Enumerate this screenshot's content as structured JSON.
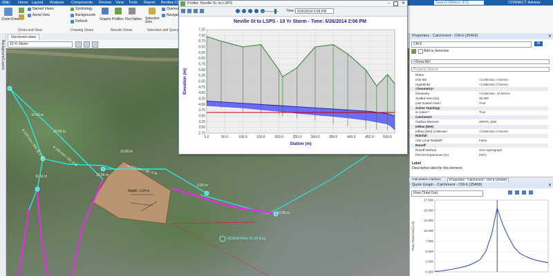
{
  "menu": [
    "File",
    "Home",
    "Layout",
    "Analysis",
    "Components",
    "Review",
    "View",
    "Tools",
    "Report",
    "Bentley Cloud Services"
  ],
  "search_placeholder": "Search Ribbon (F3)",
  "connect_label": "CONNECT Advisor",
  "ribbon": {
    "zoom_extents": "Zoom Extents",
    "named_views": "Named Views",
    "aerial_view": "Aerial View",
    "symbology": "Symbology",
    "backgrounds": "Backgrounds",
    "refresh": "Refresh",
    "graphs": "Graphs",
    "profiles": "Profiles",
    "flextables": "FlexTables",
    "selection_sets": "Selection Sets",
    "queries": "Queries",
    "navigator": "Navigator",
    "group_zoom": "Zoom and View",
    "group_drawing": "Drawing Views",
    "group_results": "Results Views",
    "group_selection": "Selection and Query"
  },
  "left_strip": "Background Layers",
  "drawing_tab": "Gerstown.stsw",
  "scenario": "10 Yr Storm",
  "profile_window": {
    "title": "Profile: Neville St. to LSPS",
    "time_label": "Time:",
    "time_value": "6/26/2014 2:06 PM",
    "chart_title": "Neville St  to LSPS - 10 Yr Storm - Time: 6/26/2014 2:06 PM",
    "xlabel": "Station (m)",
    "ylabel": "Elevation (m)"
  },
  "chart_data": [
    {
      "type": "line",
      "title": "Neville St  to LSPS - 10 Yr Storm - Time: 6/26/2014 2:06 PM",
      "xlabel": "Station (m)",
      "ylabel": "Elevation (m)",
      "xlim": [
        0,
        520
      ],
      "ylim": [
        2.75,
        7.25
      ],
      "xticks": [
        "0.0",
        "50.0",
        "100.0",
        "150.0",
        "200.0",
        "250.0",
        "300.0",
        "350.0",
        "400.0",
        "450.0",
        "500.0"
      ],
      "yticks": [
        "2.75",
        "3.00",
        "3.25",
        "3.50",
        "3.75",
        "4.00",
        "4.25",
        "4.50",
        "4.75",
        "5.00",
        "5.25",
        "5.50",
        "5.75",
        "6.00",
        "6.25",
        "6.50",
        "6.75",
        "7.00",
        "7.25"
      ],
      "series": [
        {
          "name": "",
          "color": "#2e7d32",
          "x": [
            0,
            40,
            100,
            150,
            200,
            210,
            250,
            300,
            350,
            390,
            440,
            470,
            500,
            520
          ],
          "y": [
            6.95,
            6.75,
            6.5,
            6.6,
            5.5,
            5.2,
            5.6,
            6.5,
            6.6,
            6.2,
            5.5,
            4.8,
            5.3,
            4.9
          ]
        },
        {
          "name": "",
          "color": "#1e1ea8",
          "x": [
            0,
            100,
            200,
            250,
            300,
            350,
            400,
            450,
            500,
            510,
            520
          ],
          "y": [
            4.15,
            4.05,
            3.95,
            3.9,
            3.85,
            3.8,
            3.75,
            3.7,
            3.6,
            3.55,
            3.5
          ]
        },
        {
          "name": "",
          "color": "#5a5aff",
          "x": [
            0,
            100,
            200,
            250,
            300,
            350,
            400,
            450,
            500,
            510,
            520
          ],
          "y": [
            3.95,
            3.85,
            3.7,
            3.62,
            3.55,
            3.48,
            3.4,
            3.3,
            3.15,
            3.05,
            2.9
          ]
        },
        {
          "name": "",
          "color": "#c00000",
          "x": [
            0,
            520
          ],
          "y": [
            3.65,
            3.65
          ]
        }
      ]
    },
    {
      "type": "line",
      "title": "Quick Graph - Catchment - CM-6 (25469)",
      "ylabel": "Flow (Total Out) (L/s)",
      "ylim": [
        0,
        17.5
      ],
      "yticks": [
        "0.000",
        "2.500",
        "5.000",
        "7.500",
        "10.000",
        "12.500",
        "15.000",
        "17.500"
      ],
      "series": [
        {
          "name": "Flow (Total Out)",
          "color": "#1f3fbf",
          "x": [
            0,
            1,
            2,
            3,
            4,
            5,
            6,
            7,
            8,
            9,
            10,
            11,
            12,
            13,
            14,
            15,
            16,
            17,
            18,
            19,
            20
          ],
          "y": [
            0.1,
            0.2,
            0.4,
            0.6,
            0.9,
            1.2,
            1.6,
            2.2,
            3.0,
            5.0,
            9.0,
            15.5,
            11.5,
            8.5,
            6.0,
            4.5,
            3.8,
            3.2,
            2.8,
            2.5,
            2.2
          ]
        }
      ]
    }
  ],
  "properties": {
    "header": "Properties - Catchment - CM-6 (25469)",
    "element": "CM-6",
    "unit_badge": "M",
    "add_to_selection": "Add to Selection",
    "show_all": "<Show All>",
    "search_placeholder": "Property Search",
    "rows": [
      {
        "k": "Notes",
        "v": ""
      },
      {
        "k": "GIS-IDs",
        "v": "<Collection: 0 items>"
      },
      {
        "k": "Hyperlinks",
        "v": "<Collection: 0 items>"
      },
      {
        "k": "<Geometry>",
        "v": "",
        "cat": true
      },
      {
        "k": "Geometry",
        "v": "<Collection: 43 items>"
      },
      {
        "k": "Scaled Area (ha)",
        "v": "30.690"
      },
      {
        "k": "Use Scaled Area?",
        "v": "True"
      },
      {
        "k": "Active Topology",
        "v": "",
        "cat": true
      },
      {
        "k": "Is Active?",
        "v": "True"
      },
      {
        "k": "Catchment",
        "v": "",
        "cat": true
      },
      {
        "k": "Outflow Element",
        "v": "WRPS_WW"
      },
      {
        "k": "Inflow (Wet)",
        "v": "",
        "cat": true
      },
      {
        "k": "Inflow (Wet) Collection",
        "v": "<Collection: 0 items>"
      },
      {
        "k": "Rainfall",
        "v": "",
        "cat": true
      },
      {
        "k": "Use Local Rainfall?",
        "v": "False"
      },
      {
        "k": "Runoff",
        "v": "",
        "cat": true
      },
      {
        "k": "Runoff Method",
        "v": "Unit Hydrograph"
      },
      {
        "k": "Percent Impervious (%)",
        "v": "(N/A)"
      }
    ],
    "desc_title": "Label",
    "desc_text": "Descriptive label for this element."
  },
  "bottom_tabs": [
    "Calculation Options",
    "Properties - Catchment - CM-6 (25469)"
  ],
  "quick_graph": {
    "header": "Quick Graph - Catchment - CM-6 (25469)",
    "select": "Flow (Total Out)"
  },
  "map_labels": {
    "l1": "10.60 m",
    "l2": "ø 100 mm / 850 @ 2 %",
    "l3": "10.60 m",
    "l4": "ø 100 mm / dD: 0 %",
    "l5": "10.80 m",
    "l6": "11.11 m",
    "l7": "10.56 m",
    "l8": "ø 100 mm / dD: 4 %",
    "l9": "Depth: 1.54 m",
    "l10": "10.89 m",
    "l11": "0.00 m",
    "scada": "SCADA Flow: 51.14 (L/s)"
  },
  "colors": {
    "pipe_cyan": "#2ee6e6",
    "pipe_magenta": "#e82be8",
    "catchment": "#c89a76",
    "ribbon_blue": "#1e5fa8"
  }
}
